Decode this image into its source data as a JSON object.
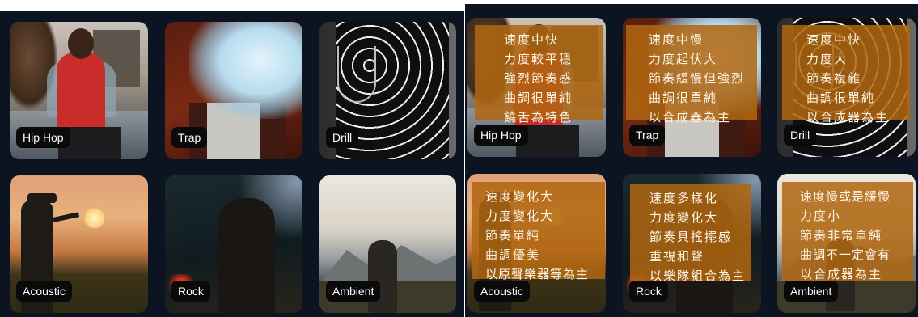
{
  "left_panel": {
    "cards": [
      {
        "genre": "Hip Hop"
      },
      {
        "genre": "Trap"
      },
      {
        "genre": "Drill"
      },
      {
        "genre": "Acoustic"
      },
      {
        "genre": "Rock"
      },
      {
        "genre": "Ambient"
      }
    ]
  },
  "right_panel": {
    "cards": [
      {
        "genre": "Hip Hop",
        "traits": [
          "速度中快",
          "力度較平穩",
          "強烈節奏感",
          "曲調很單純",
          "饒舌為特色"
        ]
      },
      {
        "genre": "Trap",
        "traits": [
          "速度中慢",
          "力度起伏大",
          "節奏緩慢但強烈",
          "曲調很單純",
          "以合成器為主"
        ]
      },
      {
        "genre": "Drill",
        "traits": [
          "速度中快",
          "力度大",
          "節奏複雜",
          "曲調很單純",
          "以合成器為主"
        ]
      },
      {
        "genre": "Acoustic",
        "traits": [
          "速度變化大",
          "力度變化大",
          "節奏單純",
          "曲調優美",
          "以原聲樂器等為主"
        ]
      },
      {
        "genre": "Rock",
        "traits": [
          "速度多樣化",
          "力度變化大",
          "節奏具搖擺感",
          "重視和聲",
          "以樂隊組合為主"
        ]
      },
      {
        "genre": "Ambient",
        "traits": [
          "速度慢或是緩慢",
          "力度小",
          "節奏非常單純",
          "曲調不一定會有",
          "以合成器為主"
        ]
      }
    ]
  },
  "colors": {
    "background": "#0b1420",
    "overlay": "#b06610",
    "tag_bg": "#0a0a0a",
    "tag_text": "#ffffff"
  }
}
